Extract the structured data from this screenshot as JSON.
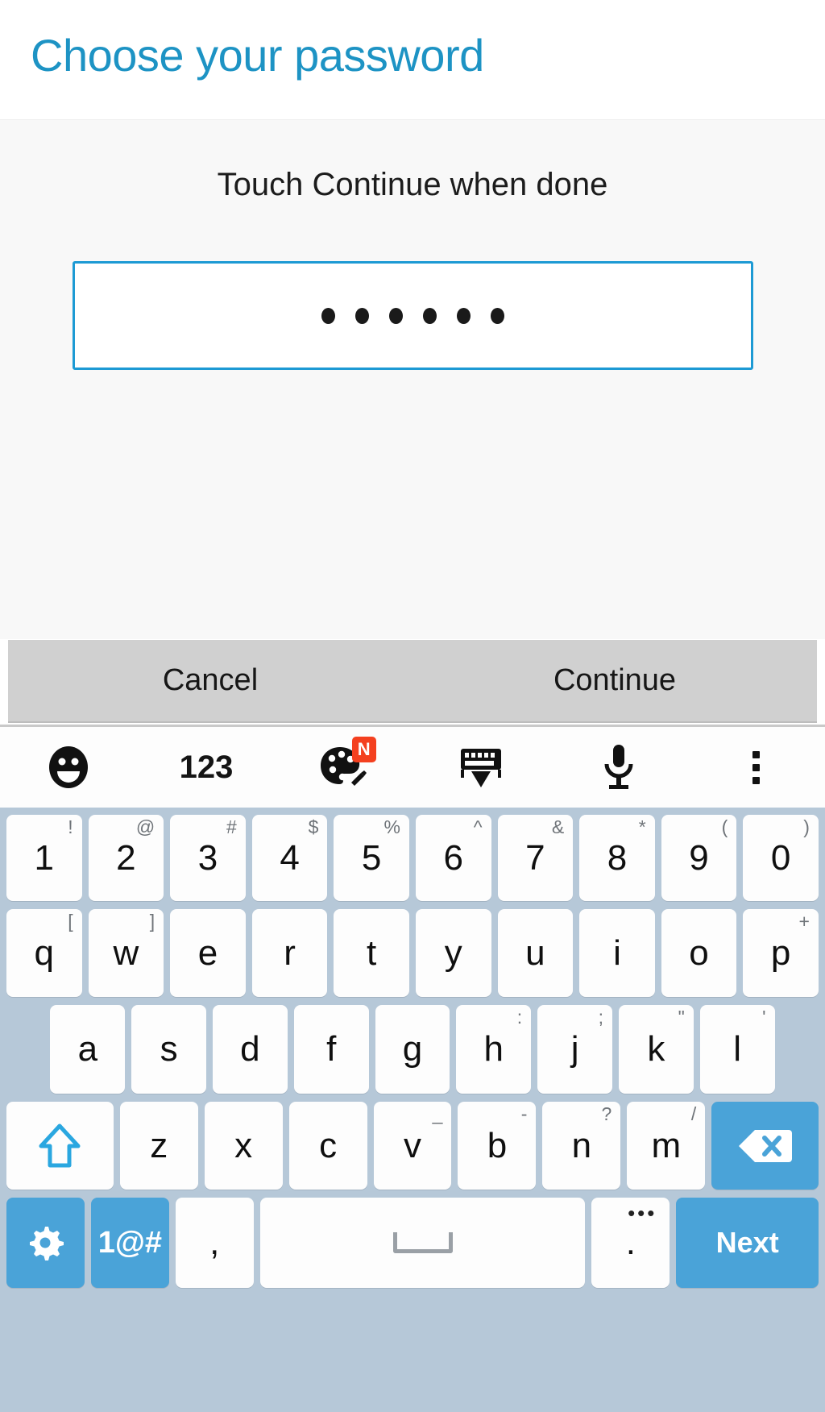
{
  "header": {
    "title": "Choose your password"
  },
  "content": {
    "prompt": "Touch Continue when done",
    "password_field": {
      "masked_char": "●",
      "length": 6
    }
  },
  "action_bar": {
    "cancel_label": "Cancel",
    "continue_label": "Continue"
  },
  "keyboard_toolbar": {
    "items": [
      {
        "name": "emoji-icon",
        "label": ""
      },
      {
        "name": "numbers-toggle",
        "label": "123"
      },
      {
        "name": "palette-icon",
        "label": "",
        "badge": "N"
      },
      {
        "name": "hide-keyboard-icon",
        "label": ""
      },
      {
        "name": "microphone-icon",
        "label": ""
      },
      {
        "name": "overflow-menu-icon",
        "label": ""
      }
    ]
  },
  "keyboard": {
    "accent_color": "#4aa3d8",
    "background_color": "#b6c8d8",
    "key_color": "#fdfdfd",
    "row_numbers": [
      {
        "main": "1",
        "sup": "!"
      },
      {
        "main": "2",
        "sup": "@"
      },
      {
        "main": "3",
        "sup": "#"
      },
      {
        "main": "4",
        "sup": "$"
      },
      {
        "main": "5",
        "sup": "%"
      },
      {
        "main": "6",
        "sup": "^"
      },
      {
        "main": "7",
        "sup": "&"
      },
      {
        "main": "8",
        "sup": "*"
      },
      {
        "main": "9",
        "sup": "("
      },
      {
        "main": "0",
        "sup": ")"
      }
    ],
    "row_top": [
      {
        "main": "q",
        "sup": "["
      },
      {
        "main": "w",
        "sup": "]"
      },
      {
        "main": "e",
        "sup": ""
      },
      {
        "main": "r",
        "sup": ""
      },
      {
        "main": "t",
        "sup": ""
      },
      {
        "main": "y",
        "sup": ""
      },
      {
        "main": "u",
        "sup": ""
      },
      {
        "main": "i",
        "sup": ""
      },
      {
        "main": "o",
        "sup": ""
      },
      {
        "main": "p",
        "sup": "+"
      }
    ],
    "row_home": [
      {
        "main": "a",
        "sup": ""
      },
      {
        "main": "s",
        "sup": ""
      },
      {
        "main": "d",
        "sup": ""
      },
      {
        "main": "f",
        "sup": ""
      },
      {
        "main": "g",
        "sup": ""
      },
      {
        "main": "h",
        "sup": ":"
      },
      {
        "main": "j",
        "sup": ";"
      },
      {
        "main": "k",
        "sup": "\""
      },
      {
        "main": "l",
        "sup": "'"
      }
    ],
    "row_bottom": [
      {
        "main": "z",
        "sup": ""
      },
      {
        "main": "x",
        "sup": ""
      },
      {
        "main": "c",
        "sup": ""
      },
      {
        "main": "v",
        "sup": "_"
      },
      {
        "main": "b",
        "sup": "-"
      },
      {
        "main": "n",
        "sup": "?"
      },
      {
        "main": "m",
        "sup": "/"
      }
    ],
    "shift_key": {
      "name": "shift-key",
      "label": ""
    },
    "backspace_key": {
      "name": "backspace-key",
      "label": ""
    },
    "settings_key": {
      "name": "settings-gear-key",
      "label": ""
    },
    "symbols_key": {
      "name": "symbols-key",
      "label": "1@#"
    },
    "comma_key": {
      "main": ",",
      "sup": ""
    },
    "space_key": {
      "name": "space-key",
      "label": ""
    },
    "period_key": {
      "main": ".",
      "sup": "•••"
    },
    "enter_key": {
      "name": "next-key",
      "label": "Next"
    }
  }
}
